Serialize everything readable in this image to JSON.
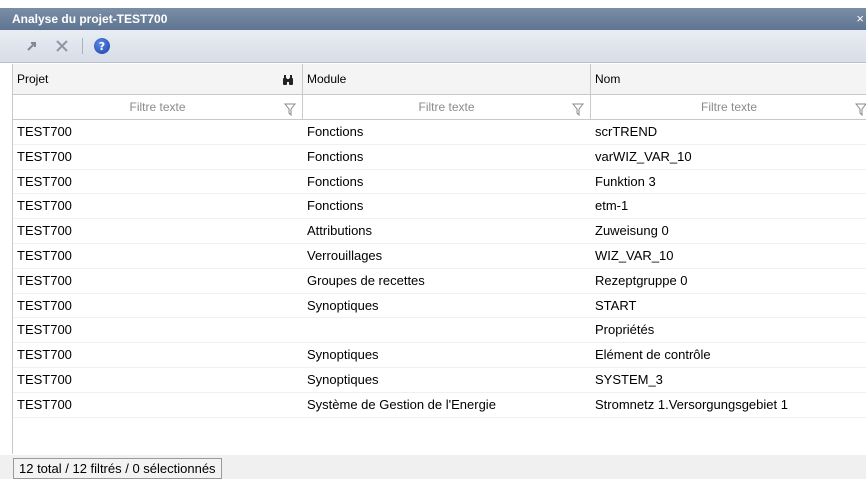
{
  "window": {
    "title": "Analyse du projet-TEST700",
    "close_glyph": "×"
  },
  "toolbar": {
    "icons": [
      "jump-arrow-icon",
      "delete-x-icon",
      "help-icon"
    ]
  },
  "columns": [
    {
      "label": "Projet",
      "filter_placeholder": "Filtre texte",
      "icon": "binoculars-icon"
    },
    {
      "label": "Module",
      "filter_placeholder": "Filtre texte"
    },
    {
      "label": "Nom",
      "filter_placeholder": "Filtre texte"
    }
  ],
  "rows": [
    {
      "projet": "TEST700",
      "module": "Fonctions",
      "nom": "scrTREND"
    },
    {
      "projet": "TEST700",
      "module": "Fonctions",
      "nom": "varWIZ_VAR_10"
    },
    {
      "projet": "TEST700",
      "module": "Fonctions",
      "nom": "Funktion 3"
    },
    {
      "projet": "TEST700",
      "module": "Fonctions",
      "nom": "etm-1"
    },
    {
      "projet": "TEST700",
      "module": "Attributions",
      "nom": "Zuweisung 0"
    },
    {
      "projet": "TEST700",
      "module": "Verrouillages",
      "nom": "WIZ_VAR_10"
    },
    {
      "projet": "TEST700",
      "module": "Groupes de recettes",
      "nom": "Rezeptgruppe 0"
    },
    {
      "projet": "TEST700",
      "module": "Synoptiques",
      "nom": "START"
    },
    {
      "projet": "TEST700",
      "module": "",
      "nom": "Propriétés"
    },
    {
      "projet": "TEST700",
      "module": "Synoptiques",
      "nom": "Elément de contrôle"
    },
    {
      "projet": "TEST700",
      "module": "Synoptiques",
      "nom": "SYSTEM_3"
    },
    {
      "projet": "TEST700",
      "module": "Système de Gestion de l'Energie",
      "nom": "Stromnetz 1.Versorgungsgebiet 1"
    }
  ],
  "status": {
    "text": "12 total / 12 filtrés / 0 sélectionnés"
  }
}
